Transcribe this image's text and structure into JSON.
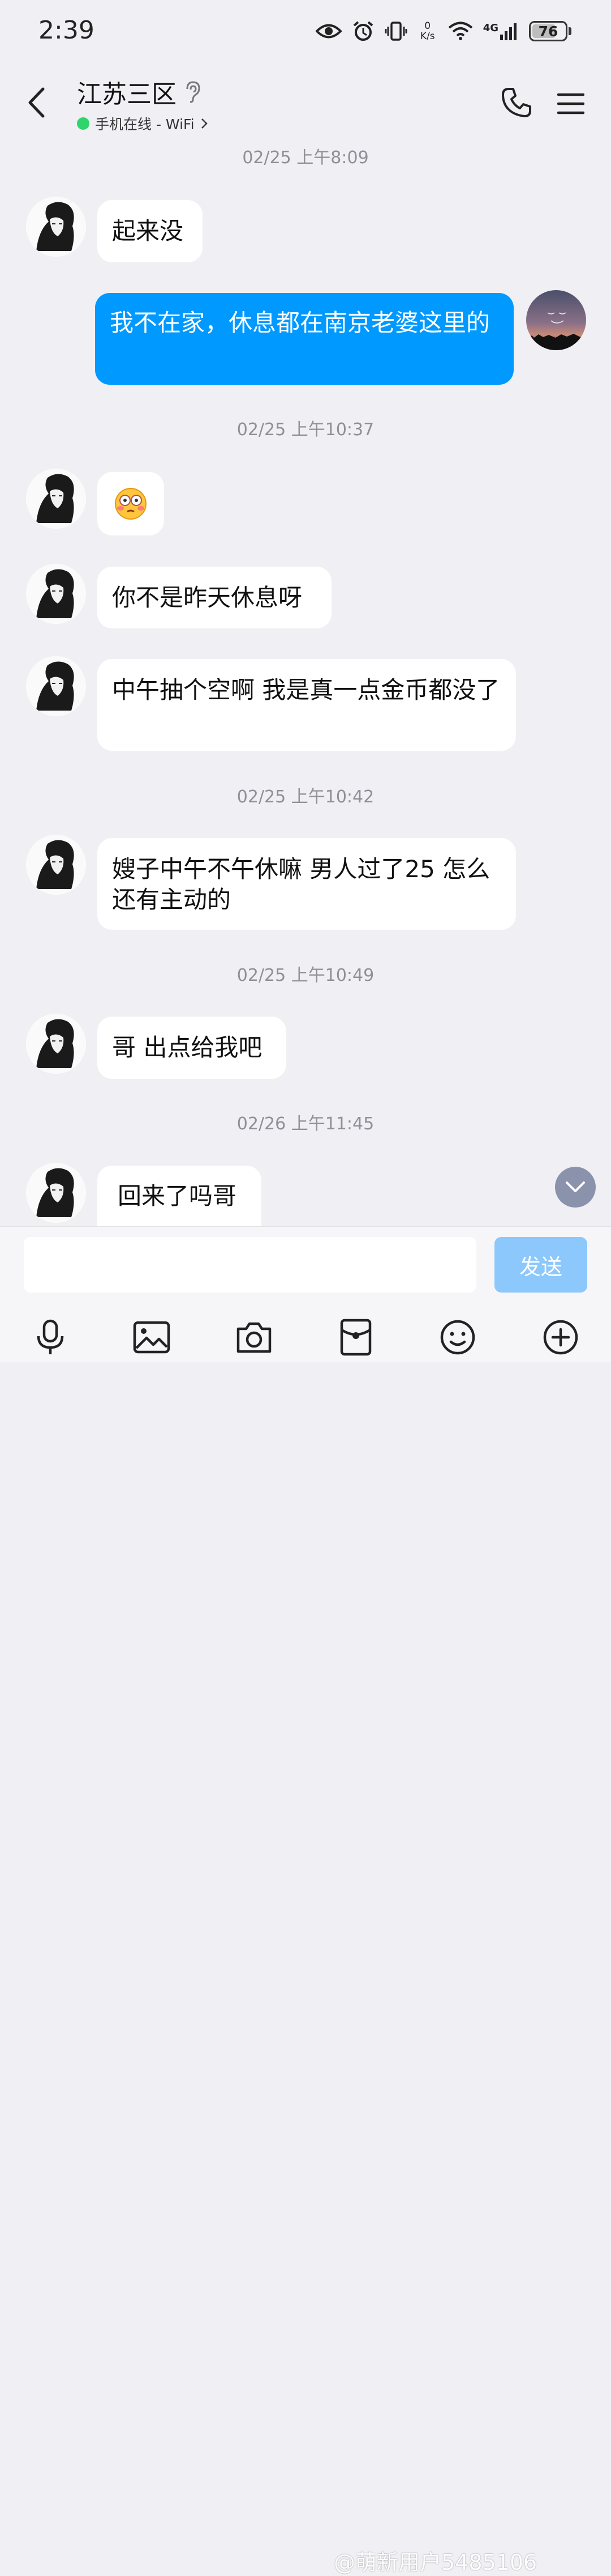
{
  "status_bar": {
    "time": "2:39",
    "net_speed_value": "0",
    "net_speed_unit": "K/s",
    "network_type": "4G",
    "battery": "76"
  },
  "header": {
    "title": "江苏三区",
    "presence": "手机在线 - WiFi"
  },
  "messages": [
    {
      "type": "timestamp",
      "text": "02/25 上午8:09"
    },
    {
      "type": "incoming",
      "text": "起来没"
    },
    {
      "type": "outgoing",
      "text": "我不在家，休息都在南京老婆这里的"
    },
    {
      "type": "timestamp",
      "text": "02/25 上午10:37"
    },
    {
      "type": "incoming",
      "text": "",
      "emoji": "flushed-face-emoji"
    },
    {
      "type": "incoming",
      "text": "你不是昨天休息呀"
    },
    {
      "type": "incoming",
      "text": "中午抽个空啊 我是真一点金币都没了"
    },
    {
      "type": "timestamp",
      "text": "02/25 上午10:42"
    },
    {
      "type": "incoming",
      "text": "嫂子中午不午休嘛 男人过了25 怎么还有主动的"
    },
    {
      "type": "timestamp",
      "text": "02/25 上午10:49"
    },
    {
      "type": "incoming",
      "text": "哥 出点给我吧"
    },
    {
      "type": "timestamp",
      "text": "02/26 上午11:45"
    },
    {
      "type": "incoming",
      "text": "回来了吗哥"
    }
  ],
  "input": {
    "value": "",
    "send_label": "发送"
  },
  "toolbar": [
    "mic-icon",
    "image-icon",
    "camera-icon",
    "red-packet-icon",
    "emoji-icon",
    "plus-icon"
  ],
  "watermark": "@萌新用户5485106",
  "colors": {
    "accent": "#0099ff",
    "online": "#2fd46a",
    "background": "#efeff4",
    "send_disabled": "#8cc8fb"
  }
}
